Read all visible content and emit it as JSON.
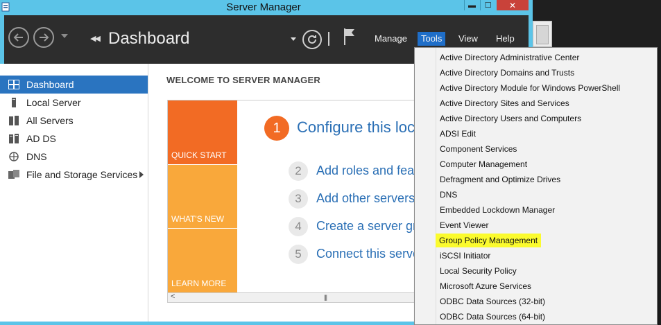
{
  "window": {
    "title": "Server Manager",
    "minimize": "▬",
    "maximize": "☐",
    "close": "✕"
  },
  "toolbar": {
    "title": "Dashboard",
    "back_icon": "back-arrow-icon",
    "forward_icon": "forward-arrow-icon",
    "menus": [
      "Manage",
      "Tools",
      "View",
      "Help"
    ],
    "active_menu": "Tools"
  },
  "sidebar": {
    "items": [
      {
        "label": "Dashboard",
        "icon": "dashboard-icon",
        "selected": true
      },
      {
        "label": "Local Server",
        "icon": "server-icon"
      },
      {
        "label": "All Servers",
        "icon": "servers-icon"
      },
      {
        "label": "AD DS",
        "icon": "ad-ds-icon"
      },
      {
        "label": "DNS",
        "icon": "dns-icon"
      },
      {
        "label": "File and Storage Services",
        "icon": "storage-icon",
        "expandable": true
      }
    ]
  },
  "main": {
    "heading": "WELCOME TO SERVER MANAGER",
    "tiles": [
      "QUICK START",
      "WHAT'S NEW",
      "LEARN MORE"
    ],
    "tile_colors": [
      "#f26b24",
      "#f9a83b",
      "#f9a83b"
    ],
    "primary_step": {
      "number": "1",
      "label": "Configure this loc"
    },
    "steps": [
      {
        "number": "2",
        "label": "Add roles and feat"
      },
      {
        "number": "3",
        "label": "Add other servers"
      },
      {
        "number": "4",
        "label": "Create a server gr"
      },
      {
        "number": "5",
        "label": "Connect this serve"
      }
    ]
  },
  "tools_menu": {
    "items": [
      "Active Directory Administrative Center",
      "Active Directory Domains and Trusts",
      "Active Directory Module for Windows PowerShell",
      "Active Directory Sites and Services",
      "Active Directory Users and Computers",
      "ADSI Edit",
      "Component Services",
      "Computer Management",
      "Defragment and Optimize Drives",
      "DNS",
      "Embedded Lockdown Manager",
      "Event Viewer",
      "Group Policy Management",
      "iSCSI Initiator",
      "Local Security Policy",
      "Microsoft Azure Services",
      "ODBC Data Sources (32-bit)",
      "ODBC Data Sources (64-bit)"
    ],
    "highlighted": "Group Policy Management",
    "highlight_color": "#fbfb2e"
  },
  "colors": {
    "accent": "#5bc4e8",
    "selection": "#2a74c0",
    "link": "#2a6fb5"
  }
}
